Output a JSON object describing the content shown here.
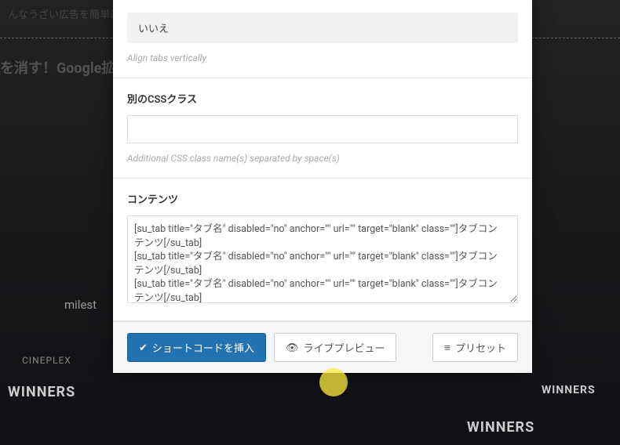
{
  "background": {
    "top_text": "んなうざい広告を簡単にシ",
    "heading": "を消す！Google拡",
    "milestone": "milest",
    "cineplex": "CINEPLEX",
    "winners": "WINNERS"
  },
  "fields": {
    "align_tabs": {
      "value": "いいえ",
      "help": "Align tabs vertically"
    },
    "css_class": {
      "label": "別のCSSクラス",
      "value": "",
      "help": "Additional CSS class name(s) separated by space(s)"
    },
    "content": {
      "label": "コンテンツ",
      "value": "[su_tab title=\"タブ名\" disabled=\"no\" anchor=\"\" url=\"\" target=\"blank\" class=\"\"]タブコンテンツ[/su_tab]\n[su_tab title=\"タブ名\" disabled=\"no\" anchor=\"\" url=\"\" target=\"blank\" class=\"\"]タブコンテンツ[/su_tab]\n[su_tab title=\"タブ名\" disabled=\"no\" anchor=\"\" url=\"\" target=\"blank\" class=\"\"]タブコンテンツ[/su_tab]"
    }
  },
  "footer": {
    "insert": "ショートコードを挿入",
    "preview": "ライブプレビュー",
    "preset": "プリセット"
  },
  "icons": {
    "check": "✔",
    "eye": "👁",
    "menu": "≡"
  }
}
